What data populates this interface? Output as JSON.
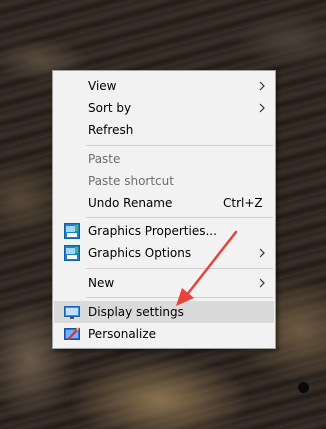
{
  "menu": {
    "items": [
      {
        "label": "View",
        "submenu": true
      },
      {
        "label": "Sort by",
        "submenu": true
      },
      {
        "label": "Refresh"
      },
      {
        "label": "Paste",
        "disabled": true
      },
      {
        "label": "Paste shortcut",
        "disabled": true
      },
      {
        "label": "Undo Rename",
        "shortcut": "Ctrl+Z"
      },
      {
        "label": "Graphics Properties...",
        "icon": "intel-graphics-icon"
      },
      {
        "label": "Graphics Options",
        "icon": "intel-graphics-icon",
        "submenu": true
      },
      {
        "label": "New",
        "submenu": true
      },
      {
        "label": "Display settings",
        "icon": "display-monitor-icon",
        "highlighted": true
      },
      {
        "label": "Personalize",
        "icon": "personalize-icon"
      }
    ]
  },
  "colors": {
    "menu_background": "#f2f2f2",
    "highlight": "#dadada",
    "disabled_text": "#6d6d6d",
    "arrow": "#e8423c"
  }
}
